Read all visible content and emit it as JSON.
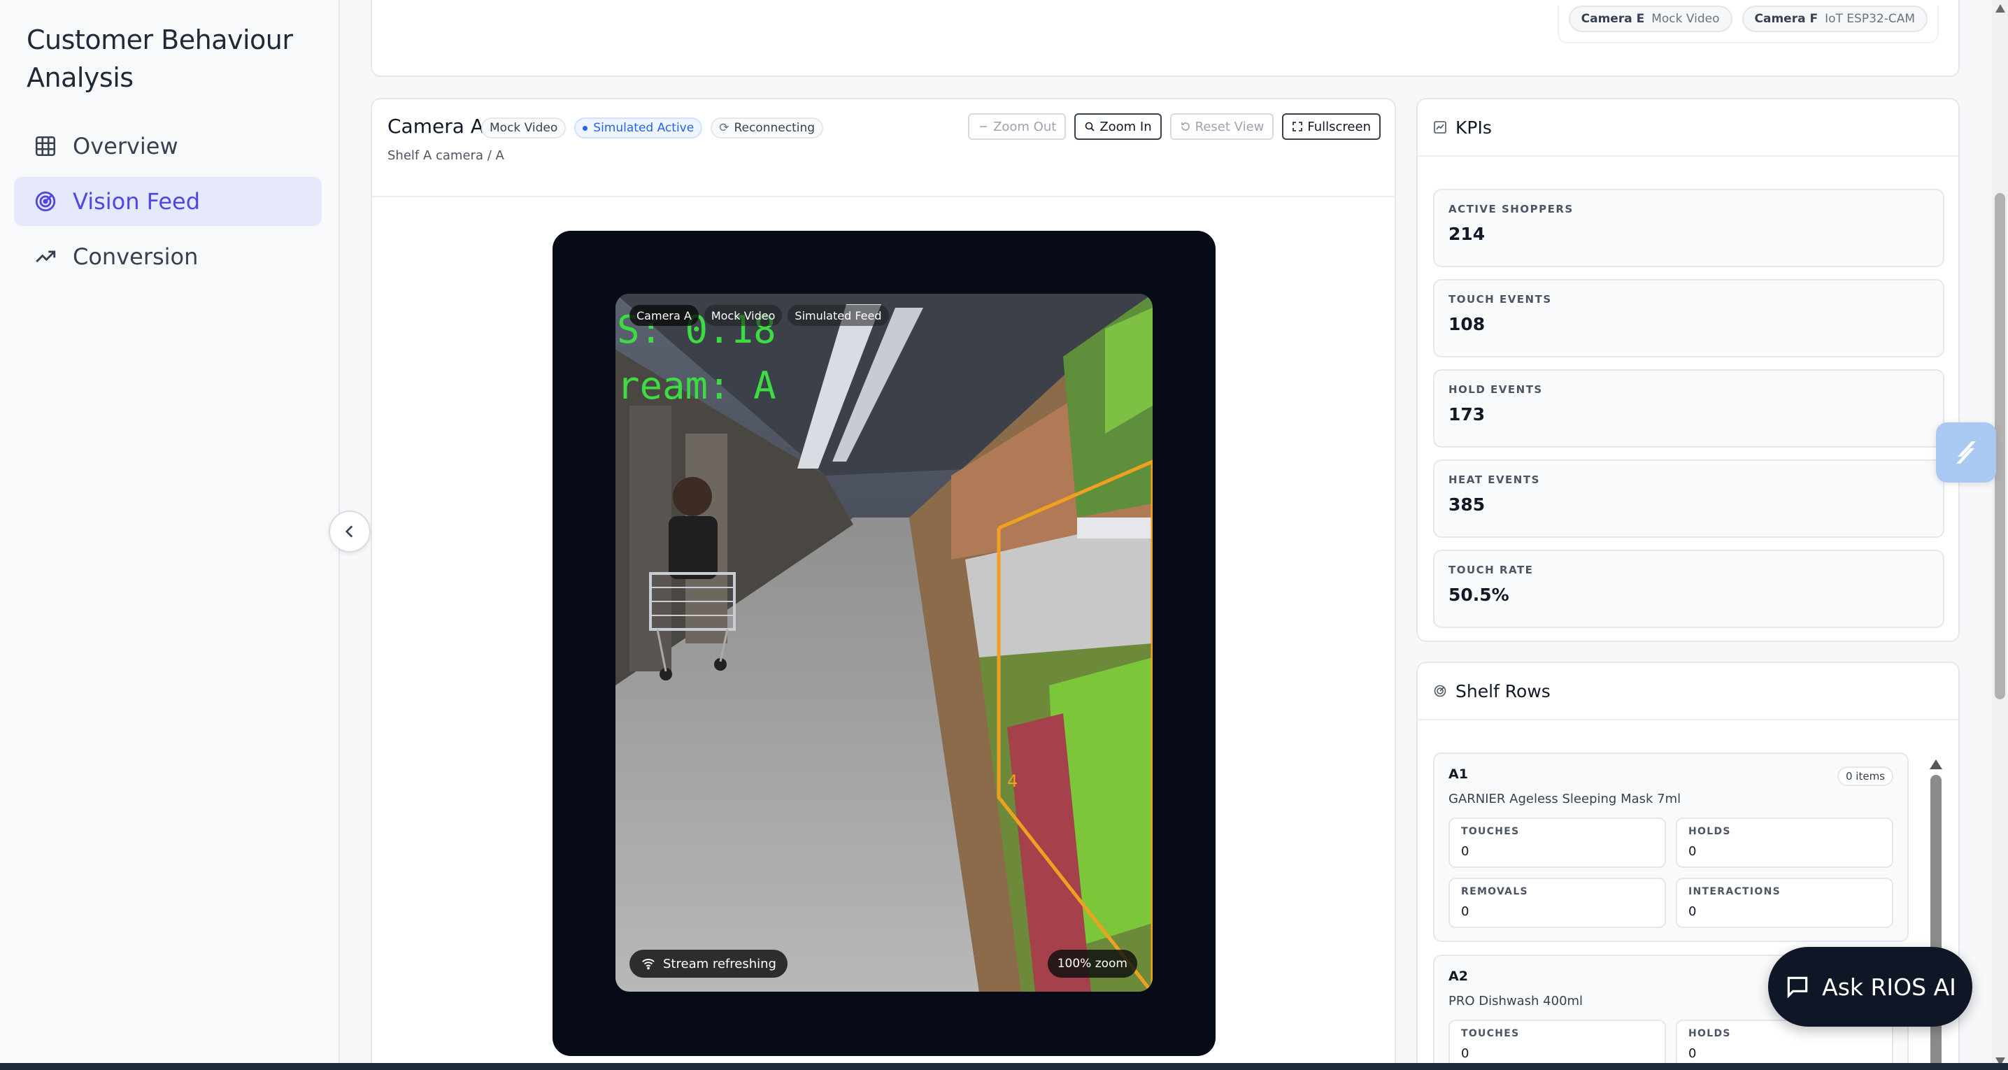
{
  "app": {
    "title": "Customer Behaviour Analysis"
  },
  "nav": {
    "items": [
      {
        "label": "Overview",
        "icon": "grid-icon",
        "active": false
      },
      {
        "label": "Vision Feed",
        "icon": "radar-icon",
        "active": true
      },
      {
        "label": "Conversion",
        "icon": "trend-up-icon",
        "active": false
      }
    ]
  },
  "top_chips": [
    {
      "camera": "Camera E",
      "type": "Mock Video"
    },
    {
      "camera": "Camera F",
      "type": "IoT ESP32-CAM"
    }
  ],
  "feed": {
    "camera_title": "Camera A",
    "badges": {
      "source": "Mock Video",
      "status": "Simulated Active",
      "connection": "Reconnecting"
    },
    "subtitle": "Shelf A camera / A",
    "toolbar": {
      "zoom_out": "Zoom Out",
      "zoom_in": "Zoom In",
      "reset": "Reset View",
      "fullscreen": "Fullscreen"
    },
    "video": {
      "tags": [
        "Camera A",
        "Mock Video",
        "Simulated Feed"
      ],
      "overlay_text": [
        "S: 0.18",
        "ream: A"
      ],
      "zone_label": "4",
      "stream_status": "Stream refreshing",
      "zoom": "100% zoom"
    }
  },
  "kpis": {
    "title": "KPIs",
    "items": [
      {
        "label": "ACTIVE SHOPPERS",
        "value": "214"
      },
      {
        "label": "TOUCH EVENTS",
        "value": "108"
      },
      {
        "label": "HOLD EVENTS",
        "value": "173"
      },
      {
        "label": "HEAT EVENTS",
        "value": "385"
      },
      {
        "label": "TOUCH RATE",
        "value": "50.5%"
      }
    ]
  },
  "shelf_rows": {
    "title": "Shelf Rows",
    "rows": [
      {
        "code": "A1",
        "items": "0 items",
        "product": "GARNIER Ageless Sleeping Mask 7ml",
        "touches_label": "TOUCHES",
        "touches": "0",
        "holds_label": "HOLDS",
        "holds": "0",
        "removals_label": "REMOVALS",
        "removals": "0",
        "interactions_label": "INTERACTIONS",
        "interactions": "0"
      },
      {
        "code": "A2",
        "product": "PRO Dishwash 400ml",
        "touches_label": "TOUCHES",
        "touches": "0",
        "holds_label": "HOLDS",
        "holds": "0"
      }
    ]
  },
  "assistant": {
    "label": "Ask RIOS AI"
  },
  "colors": {
    "accent": "#4f46e5",
    "active_nav_bg": "#e6e8fb",
    "dark": "#0f1726",
    "overlay_green": "#3ddc44",
    "zone_orange": "#f0a020"
  }
}
